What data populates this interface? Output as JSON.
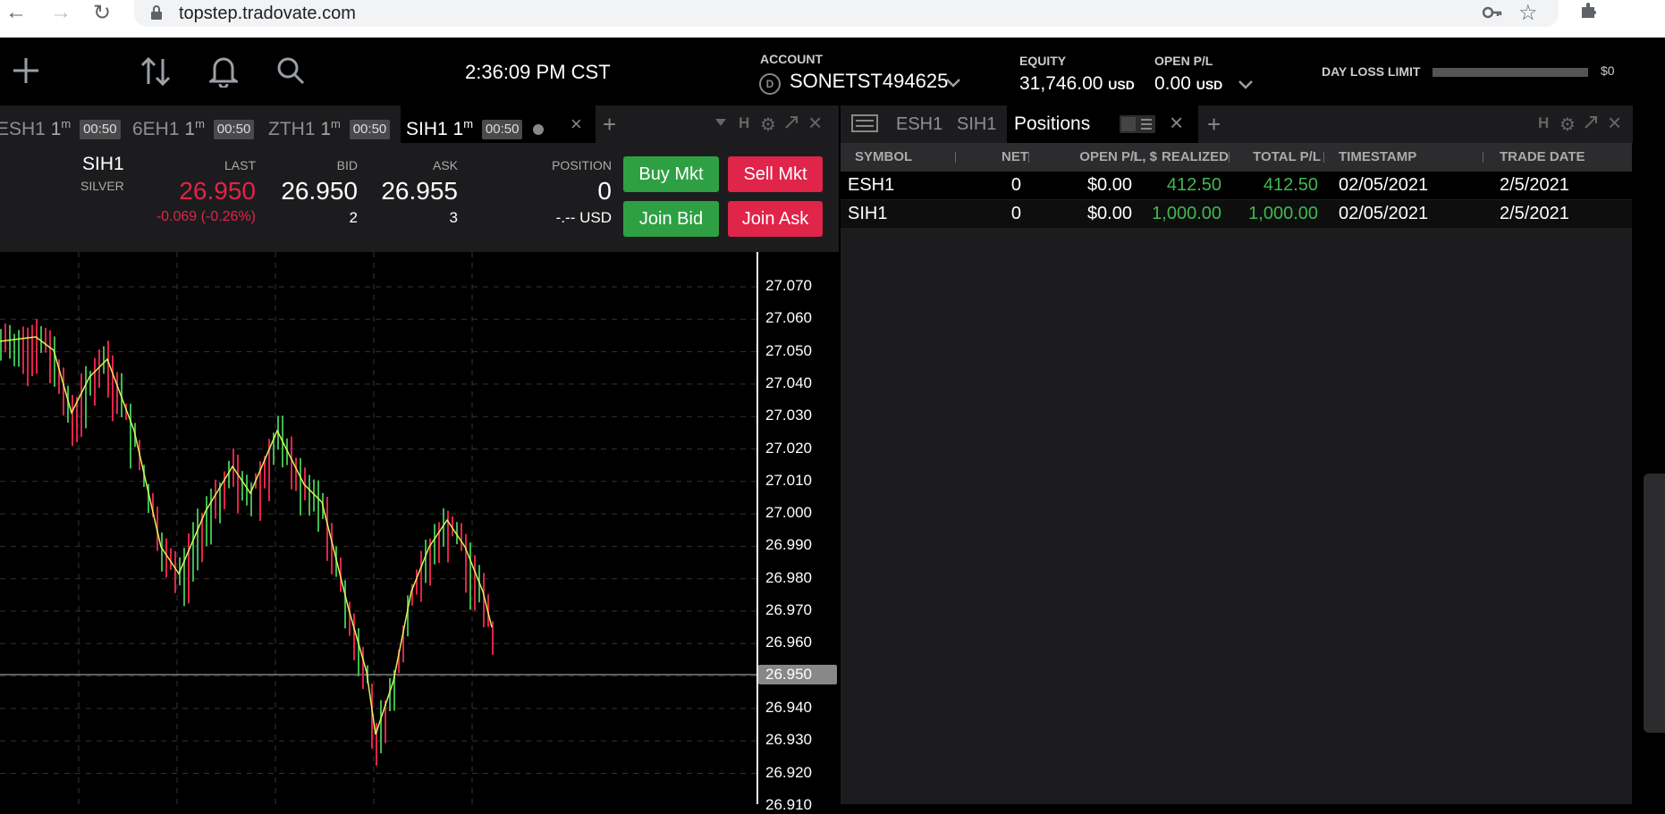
{
  "browser": {
    "url": "topstep.tradovate.com"
  },
  "toolbar": {
    "clock": "2:36:09 PM CST",
    "account_label": "ACCOUNT",
    "account_badge": "D",
    "account_value": "SONETST494625",
    "equity_label": "EQUITY",
    "equity_value": "31,746.00",
    "equity_currency": "USD",
    "open_pl_label": "OPEN P/L",
    "open_pl_value": "0.00",
    "open_pl_currency": "USD",
    "day_loss_label": "DAY LOSS LIMIT",
    "day_loss_value": "$0"
  },
  "chart_tabs": [
    {
      "label": "ESH1",
      "interval": "1",
      "unit": "m",
      "countdown": "00:50"
    },
    {
      "label": "6EH1",
      "interval": "1",
      "unit": "m",
      "countdown": "00:50"
    },
    {
      "label": "ZTH1",
      "interval": "1",
      "unit": "m",
      "countdown": "00:50"
    },
    {
      "label": "SIH1",
      "interval": "1",
      "unit": "m",
      "countdown": "00:50"
    }
  ],
  "tab_bar_letter": "H",
  "quote": {
    "symbol": "SIH1",
    "name": "SILVER",
    "last_label": "LAST",
    "last": "26.950",
    "change": "-0.069 (-0.26%)",
    "bid_label": "BID",
    "bid": "26.950",
    "bid_size": "2",
    "ask_label": "ASK",
    "ask": "26.955",
    "ask_size": "3",
    "position_label": "POSITION",
    "position": "0",
    "position_usd": "-.-- USD",
    "buy_mkt": "Buy Mkt",
    "sell_mkt": "Sell Mkt",
    "join_bid": "Join Bid",
    "join_ask": "Join Ask"
  },
  "price_axis": {
    "ticks": [
      "27.070",
      "27.060",
      "27.050",
      "27.040",
      "27.030",
      "27.020",
      "27.010",
      "27.000",
      "26.990",
      "26.980",
      "26.970",
      "26.960",
      "26.950",
      "26.940",
      "26.930",
      "26.920",
      "26.910"
    ],
    "current": "26.950"
  },
  "colors": {
    "up": "#3fb950",
    "down": "#e0244a",
    "ma": "#d7f55a",
    "accent_green": "#2ea043",
    "accent_red": "#e0244a"
  },
  "right_tabs": {
    "tab1": "ESH1",
    "tab2": "SIH1",
    "active": "Positions",
    "letter": "H"
  },
  "positions": {
    "headers": [
      "SYMBOL",
      "NET",
      "OPEN P/L, $",
      "REALIZED",
      "TOTAL P/L",
      "TIMESTAMP",
      "TRADE DATE"
    ],
    "rows": [
      {
        "symbol": "ESH1",
        "net": "0",
        "open_pl": "$0.00",
        "realized": "412.50",
        "total_pl": "412.50",
        "timestamp": "02/05/2021",
        "trade_date": "2/5/2021"
      },
      {
        "symbol": "SIH1",
        "net": "0",
        "open_pl": "$0.00",
        "realized": "1,000.00",
        "total_pl": "1,000.00",
        "timestamp": "02/05/2021",
        "trade_date": "2/5/2021"
      }
    ]
  }
}
